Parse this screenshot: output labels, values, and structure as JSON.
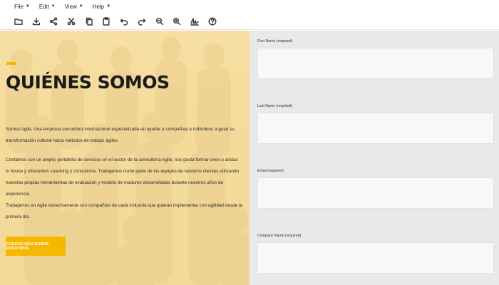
{
  "menu": [
    {
      "label": "File"
    },
    {
      "label": "Edit"
    },
    {
      "label": "View"
    },
    {
      "label": "Help"
    }
  ],
  "toolbar": [
    "open-folder-icon",
    "download-icon",
    "share-icon",
    "cut-icon",
    "copy-icon",
    "paste-icon",
    "undo-icon",
    "redo-icon",
    "zoom-out-icon",
    "zoom-in-icon",
    "signature-icon",
    "help-icon"
  ],
  "hero": {
    "title": "QUIÉNES SOMOS",
    "paragraphs": [
      "Somos Agile, Una empresa consultora internacional especializada en ayudar a compañías e individuos a guiar su transformación cultural hacia métodos de trabajo ágiles.",
      "Contamos con un amplio portafolio de servicios en el sector de la consultoría Agile, nos gusta formar ones o alistas in house y ofrecemos coaching y consultoría. Trabajamos como parte de los equipos de nuestros clientes utilizando nuestras propias herramientas de evaluación y modelo de madurez desarrolladas durante nuestros años de experiencia.",
      "Trabajamos en Agile estrechamente con compañías de cada industria que quieran implementar con agilidad desde la primera día."
    ],
    "cta": "CONOCE MÁS SOBRE NOSOTROS",
    "accent_color": "#f5b800"
  },
  "form": {
    "fields": [
      {
        "label": "First Name (required)"
      },
      {
        "label": "Last Name (required)"
      },
      {
        "label": "Email (required)"
      },
      {
        "label": "Company Name (required)"
      }
    ]
  }
}
